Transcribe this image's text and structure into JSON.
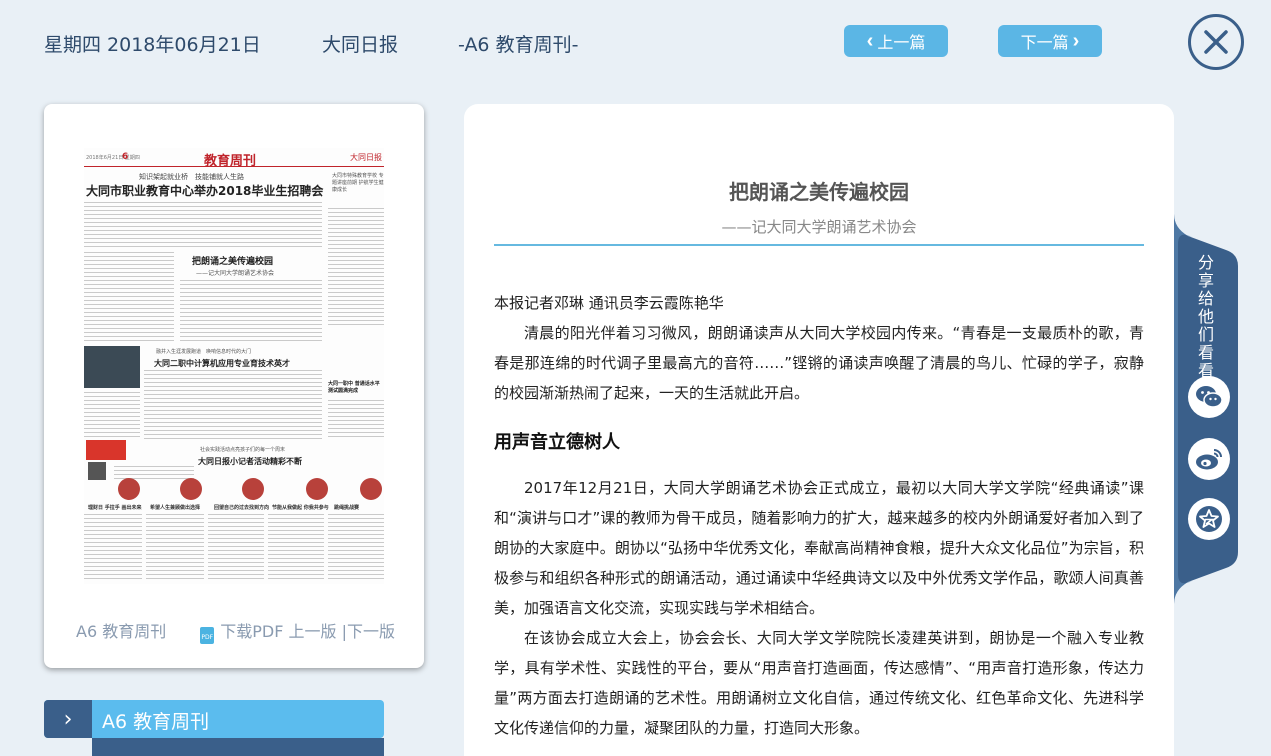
{
  "header": {
    "date": "星期四 2018年06月21日",
    "paper": "大同日报",
    "edition": "-A6 教育周刊-",
    "prev_label": "上一篇",
    "next_label": "下一篇"
  },
  "thumbnail": {
    "masthead": "教育周刊",
    "page_num": "6",
    "top_left": "2018年6月21日 星期四",
    "logo": "大同日报",
    "subhead": "知识架起就业桥　技能铺就人生路",
    "headline": "大同市职业教育中心举办2018毕业生招聘会",
    "side_title": "大同市特殊教育学校 专题讲座前期 护航学生健康成长",
    "story2_title": "把朗诵之美传遍校园",
    "story2_sub": "——记大同大学朗诵艺术协会",
    "story3_sub": "融并入生涯发展跑道　唤响信息时代的大门",
    "story3_title": "大同二职中计算机应用专业育技术英才",
    "side2_title": "大同一职中 普通话水平测试圆满完成",
    "story4_sub": "社会实践活动点亮孩子们的每一个周末",
    "story4_title": "大同日报小记者活动精彩不断",
    "caption1": "理财日 手拉手 画出未来",
    "caption2": "希望人生兼顾做出选择",
    "caption3": "回望自己的过去找到方向",
    "caption4": "节能从我做起 你我共参与",
    "caption5": "跳绳挑战赛"
  },
  "card_footer": {
    "edition_link": "A6 教育周刊",
    "pdf_icon_text": "PDF",
    "download": "下载PDF",
    "prev_page": "上一版",
    "separator": " |",
    "next_page": "下一版"
  },
  "section_nav": {
    "label": "A6 教育周刊"
  },
  "article": {
    "title": "把朗诵之美传遍校园",
    "subtitle": "——记大同大学朗诵艺术协会",
    "byline": "本报记者邓琳 通讯员李云霞陈艳华",
    "p1": "清晨的阳光伴着习习微风，朗朗诵读声从大同大学校园内传来。“青春是一支最质朴的歌，青春是那连绵的时代调子里最高亢的音符……”铿锵的诵读声唤醒了清晨的鸟儿、忙碌的学子，寂静的校园渐渐热闹了起来，一天的生活就此开启。",
    "section_head": "用声音立德树人",
    "p2": "2017年12月21日，大同大学朗诵艺术协会正式成立，最初以大同大学文学院“经典诵读”课和“演讲与口才”课的教师为骨干成员，随着影响力的扩大，越来越多的校内外朗诵爱好者加入到了朗协的大家庭中。朗协以“弘扬中华优秀文化，奉献高尚精神食粮，提升大众文化品位”为宗旨，积极参与和组织各种形式的朗诵活动，通过诵读中华经典诗文以及中外优秀文学作品，歌颂人间真善美，加强语言文化交流，实现实践与学术相结合。",
    "p3": "在该协会成立大会上，协会会长、大同大学文学院院长凌建英讲到，朗协是一个融入专业教学，具有学术性、实践性的平台，要从“用声音打造画面，传达感情”、“用声音打造形象，传达力量”两方面去打造朗诵的艺术性。用朗诵树立文化自信，通过传统文化、红色革命文化、先进科学文化传递信仰的力量，凝聚团队的力量，打造同大形象。"
  },
  "share": {
    "label": "分享给他们看看",
    "icons": [
      "wechat-icon",
      "weibo-icon",
      "favorite-star-icon"
    ]
  },
  "colors": {
    "page_bg": "#e9f0f6",
    "accent_blue": "#5bb6e5",
    "dark_blue": "#3a5f8a",
    "rule_blue": "#66b9e0"
  }
}
